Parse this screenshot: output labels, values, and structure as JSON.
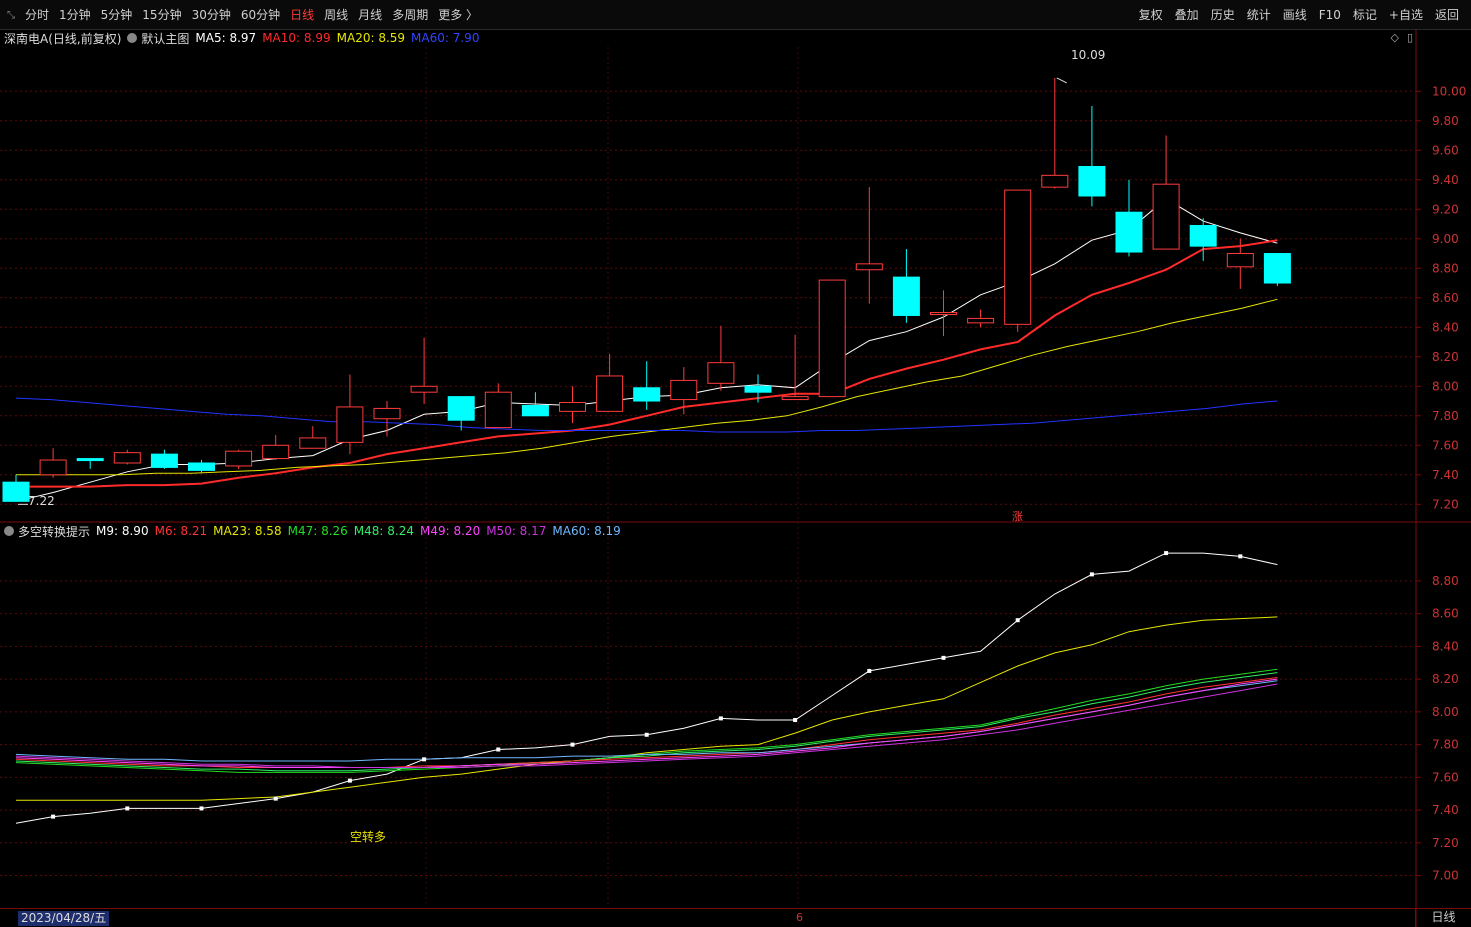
{
  "toolbar": {
    "left_items": [
      "分时",
      "1分钟",
      "5分钟",
      "15分钟",
      "30分钟",
      "60分钟",
      "日线",
      "周线",
      "月线",
      "多周期",
      "更多 〉"
    ],
    "active": "日线",
    "right_items": [
      "复权",
      "叠加",
      "历史",
      "统计",
      "画线",
      "F10",
      "标记",
      "+自选",
      "返回"
    ]
  },
  "main_indicator": {
    "stock": "深南电A",
    "mode": "(日线,前复权)",
    "template": "默认主图",
    "ma5": "MA5: 8.97",
    "ma10": "MA10: 8.99",
    "ma20": "MA20: 8.59",
    "ma60": "MA60: 7.90",
    "colors": {
      "ma5": "#ffffff",
      "ma10": "#ff2a2a",
      "ma20": "#e6e600",
      "ma60": "#2233ff"
    }
  },
  "sub_indicator": {
    "name": "多空转换提示",
    "m9": "M9: 8.90",
    "m6": "M6: 8.21",
    "ma23": "MA23: 8.58",
    "m47": "M47: 8.26",
    "m48": "M48: 8.24",
    "m49": "M49: 8.20",
    "m50": "M50: 8.17",
    "ma60": "MA60: 8.19"
  },
  "annotations": {
    "high": "10.09",
    "low": "7.22",
    "zhang": "涨",
    "signal": "空转多"
  },
  "status": {
    "date": "2023/04/28/五",
    "month_mark": "6",
    "period": "日线"
  },
  "chart_data": {
    "type": "candlestick",
    "main_axis": {
      "ticks": [
        7.2,
        7.4,
        7.6,
        7.8,
        8.0,
        8.2,
        8.4,
        8.6,
        8.8,
        9.0,
        9.2,
        9.4,
        9.6,
        9.8,
        10.0
      ],
      "range": [
        7.08,
        10.3
      ]
    },
    "sub_axis": {
      "ticks": [
        7.0,
        7.2,
        7.4,
        7.6,
        7.8,
        8.0,
        8.2,
        8.4,
        8.6,
        8.8
      ],
      "range": [
        6.82,
        9.05
      ]
    },
    "candles": [
      {
        "o": 7.35,
        "h": 7.4,
        "l": 7.22,
        "c": 7.22
      },
      {
        "o": 7.4,
        "h": 7.58,
        "l": 7.38,
        "c": 7.5
      },
      {
        "o": 7.51,
        "h": 7.51,
        "l": 7.44,
        "c": 7.5
      },
      {
        "o": 7.48,
        "h": 7.57,
        "l": 7.47,
        "c": 7.55
      },
      {
        "o": 7.54,
        "h": 7.57,
        "l": 7.44,
        "c": 7.45
      },
      {
        "o": 7.48,
        "h": 7.5,
        "l": 7.41,
        "c": 7.43
      },
      {
        "o": 7.46,
        "h": 7.57,
        "l": 7.44,
        "c": 7.56
      },
      {
        "o": 7.51,
        "h": 7.67,
        "l": 7.5,
        "c": 7.6
      },
      {
        "o": 7.58,
        "h": 7.73,
        "l": 7.58,
        "c": 7.65
      },
      {
        "o": 7.62,
        "h": 8.08,
        "l": 7.54,
        "c": 7.86
      },
      {
        "o": 7.78,
        "h": 7.9,
        "l": 7.66,
        "c": 7.85
      },
      {
        "o": 7.96,
        "h": 8.33,
        "l": 7.88,
        "c": 8.0
      },
      {
        "o": 7.93,
        "h": 7.93,
        "l": 7.7,
        "c": 7.77
      },
      {
        "o": 7.72,
        "h": 8.02,
        "l": 7.72,
        "c": 7.96
      },
      {
        "o": 7.87,
        "h": 7.96,
        "l": 7.81,
        "c": 7.8
      },
      {
        "o": 7.83,
        "h": 8.0,
        "l": 7.75,
        "c": 7.89
      },
      {
        "o": 7.83,
        "h": 8.22,
        "l": 7.83,
        "c": 8.07
      },
      {
        "o": 7.99,
        "h": 8.17,
        "l": 7.84,
        "c": 7.9
      },
      {
        "o": 7.91,
        "h": 8.13,
        "l": 7.81,
        "c": 8.04
      },
      {
        "o": 8.02,
        "h": 8.41,
        "l": 7.97,
        "c": 8.16
      },
      {
        "o": 8.0,
        "h": 8.08,
        "l": 7.89,
        "c": 7.96
      },
      {
        "o": 7.91,
        "h": 8.35,
        "l": 7.91,
        "c": 7.93
      },
      {
        "o": 7.93,
        "h": 8.72,
        "l": 7.93,
        "c": 8.72
      },
      {
        "o": 8.79,
        "h": 9.35,
        "l": 8.56,
        "c": 8.83
      },
      {
        "o": 8.74,
        "h": 8.93,
        "l": 8.43,
        "c": 8.48
      },
      {
        "o": 8.5,
        "h": 8.65,
        "l": 8.34,
        "c": 8.5
      },
      {
        "o": 8.43,
        "h": 8.52,
        "l": 8.4,
        "c": 8.46
      },
      {
        "o": 8.42,
        "h": 9.33,
        "l": 8.37,
        "c": 9.33
      },
      {
        "o": 9.35,
        "h": 10.09,
        "l": 9.34,
        "c": 9.43
      },
      {
        "o": 9.49,
        "h": 9.9,
        "l": 9.22,
        "c": 9.29
      },
      {
        "o": 9.18,
        "h": 9.4,
        "l": 8.88,
        "c": 8.91
      },
      {
        "o": 8.93,
        "h": 9.7,
        "l": 8.93,
        "c": 9.37
      },
      {
        "o": 9.09,
        "h": 9.14,
        "l": 8.85,
        "c": 8.95
      },
      {
        "o": 8.81,
        "h": 9.0,
        "l": 8.66,
        "c": 8.9
      },
      {
        "o": 8.9,
        "h": 8.9,
        "l": 8.68,
        "c": 8.7
      }
    ],
    "series_main": [
      {
        "name": "MA5",
        "color": "#ffffff",
        "values": [
          7.22,
          7.28,
          7.35,
          7.42,
          7.47,
          7.47,
          7.48,
          7.51,
          7.53,
          7.64,
          7.7,
          7.81,
          7.83,
          7.89,
          7.88,
          7.87,
          7.9,
          7.93,
          7.94,
          7.99,
          8.01,
          7.99,
          8.16,
          8.31,
          8.37,
          8.47,
          8.62,
          8.71,
          8.83,
          8.99,
          9.06,
          9.27,
          9.12,
          9.04,
          8.97
        ]
      },
      {
        "name": "MA10",
        "color": "#ff2a2a",
        "values": [
          7.32,
          7.32,
          7.32,
          7.33,
          7.33,
          7.34,
          7.38,
          7.41,
          7.45,
          7.48,
          7.54,
          7.58,
          7.62,
          7.66,
          7.68,
          7.7,
          7.74,
          7.8,
          7.86,
          7.89,
          7.92,
          7.95,
          7.95,
          8.05,
          8.12,
          8.18,
          8.25,
          8.3,
          8.48,
          8.62,
          8.7,
          8.79,
          8.93,
          8.95,
          8.99
        ]
      },
      {
        "name": "MA20",
        "color": "#e6e600",
        "values": [
          7.4,
          7.4,
          7.4,
          7.4,
          7.41,
          7.41,
          7.42,
          7.43,
          7.45,
          7.46,
          7.47,
          7.49,
          7.51,
          7.53,
          7.55,
          7.58,
          7.62,
          7.66,
          7.69,
          7.72,
          7.75,
          7.77,
          7.8,
          7.86,
          7.93,
          7.98,
          8.03,
          8.07,
          8.14,
          8.21,
          8.27,
          8.32,
          8.37,
          8.43,
          8.48,
          8.53,
          8.59
        ]
      },
      {
        "name": "MA60",
        "color": "#2233ff",
        "values": [
          7.92,
          7.91,
          7.89,
          7.87,
          7.85,
          7.83,
          7.81,
          7.8,
          7.78,
          7.76,
          7.76,
          7.75,
          7.74,
          7.72,
          7.71,
          7.7,
          7.7,
          7.7,
          7.7,
          7.7,
          7.69,
          7.69,
          7.69,
          7.7,
          7.7,
          7.71,
          7.72,
          7.73,
          7.74,
          7.75,
          7.77,
          7.79,
          7.81,
          7.83,
          7.85,
          7.88,
          7.9
        ]
      }
    ],
    "series_sub": [
      {
        "name": "M9",
        "color": "#ffffff",
        "values": [
          7.32,
          7.36,
          7.38,
          7.41,
          7.41,
          7.41,
          7.44,
          7.47,
          7.51,
          7.58,
          7.62,
          7.71,
          7.72,
          7.77,
          7.78,
          7.8,
          7.85,
          7.86,
          7.9,
          7.96,
          7.95,
          7.95,
          8.1,
          8.25,
          8.29,
          8.33,
          8.37,
          8.56,
          8.72,
          8.84,
          8.86,
          8.97,
          8.97,
          8.95,
          8.9
        ]
      },
      {
        "name": "MA23",
        "color": "#e6e600",
        "values": [
          7.46,
          7.46,
          7.46,
          7.46,
          7.46,
          7.46,
          7.47,
          7.48,
          7.51,
          7.54,
          7.57,
          7.6,
          7.62,
          7.65,
          7.68,
          7.7,
          7.72,
          7.75,
          7.77,
          7.79,
          7.8,
          7.87,
          7.95,
          8.0,
          8.04,
          8.08,
          8.18,
          8.28,
          8.36,
          8.41,
          8.49,
          8.53,
          8.56,
          8.57,
          8.58
        ]
      },
      {
        "name": "M47",
        "color": "#22dd22",
        "values": [
          7.69,
          7.68,
          7.67,
          7.66,
          7.65,
          7.64,
          7.63,
          7.63,
          7.63,
          7.63,
          7.64,
          7.65,
          7.66,
          7.67,
          7.69,
          7.7,
          7.72,
          7.74,
          7.76,
          7.77,
          7.78,
          7.8,
          7.83,
          7.86,
          7.88,
          7.9,
          7.92,
          7.97,
          8.02,
          8.07,
          8.11,
          8.16,
          8.2,
          8.23,
          8.26
        ]
      },
      {
        "name": "M48",
        "color": "#33ee66",
        "values": [
          7.7,
          7.69,
          7.68,
          7.67,
          7.66,
          7.65,
          7.65,
          7.64,
          7.64,
          7.64,
          7.65,
          7.66,
          7.67,
          7.68,
          7.69,
          7.7,
          7.72,
          7.73,
          7.75,
          7.76,
          7.77,
          7.79,
          7.82,
          7.85,
          7.87,
          7.89,
          7.91,
          7.96,
          8.0,
          8.05,
          8.09,
          8.14,
          8.18,
          8.21,
          8.24
        ]
      },
      {
        "name": "M6",
        "color": "#ff3333",
        "values": [
          7.71,
          7.7,
          7.69,
          7.68,
          7.67,
          7.67,
          7.66,
          7.66,
          7.66,
          7.66,
          7.66,
          7.67,
          7.67,
          7.68,
          7.69,
          7.7,
          7.71,
          7.72,
          7.73,
          7.74,
          7.75,
          7.77,
          7.8,
          7.83,
          7.85,
          7.87,
          7.89,
          7.93,
          7.98,
          8.02,
          8.06,
          8.11,
          8.15,
          8.18,
          8.21
        ]
      },
      {
        "name": "MA60",
        "color": "#6fb8ff",
        "values": [
          7.74,
          7.73,
          7.72,
          7.71,
          7.71,
          7.7,
          7.7,
          7.7,
          7.7,
          7.7,
          7.71,
          7.71,
          7.72,
          7.72,
          7.72,
          7.73,
          7.73,
          7.74,
          7.74,
          7.75,
          7.75,
          7.77,
          7.79,
          7.81,
          7.83,
          7.85,
          7.88,
          7.92,
          7.96,
          8.0,
          8.04,
          8.09,
          8.13,
          8.16,
          8.19
        ]
      },
      {
        "name": "M49",
        "color": "#ff44ff",
        "values": [
          7.72,
          7.71,
          7.7,
          7.69,
          7.68,
          7.67,
          7.67,
          7.66,
          7.66,
          7.66,
          7.66,
          7.66,
          7.67,
          7.68,
          7.68,
          7.69,
          7.7,
          7.71,
          7.72,
          7.73,
          7.74,
          7.76,
          7.78,
          7.81,
          7.83,
          7.85,
          7.88,
          7.92,
          7.96,
          8.0,
          8.04,
          8.09,
          8.13,
          8.17,
          8.2
        ]
      },
      {
        "name": "M50",
        "color": "#cc33dd",
        "values": [
          7.73,
          7.72,
          7.71,
          7.7,
          7.69,
          7.68,
          7.68,
          7.67,
          7.67,
          7.66,
          7.66,
          7.66,
          7.66,
          7.67,
          7.67,
          7.68,
          7.69,
          7.7,
          7.71,
          7.72,
          7.73,
          7.75,
          7.77,
          7.79,
          7.81,
          7.83,
          7.86,
          7.89,
          7.93,
          7.97,
          8.01,
          8.05,
          8.09,
          8.13,
          8.17
        ]
      }
    ]
  }
}
